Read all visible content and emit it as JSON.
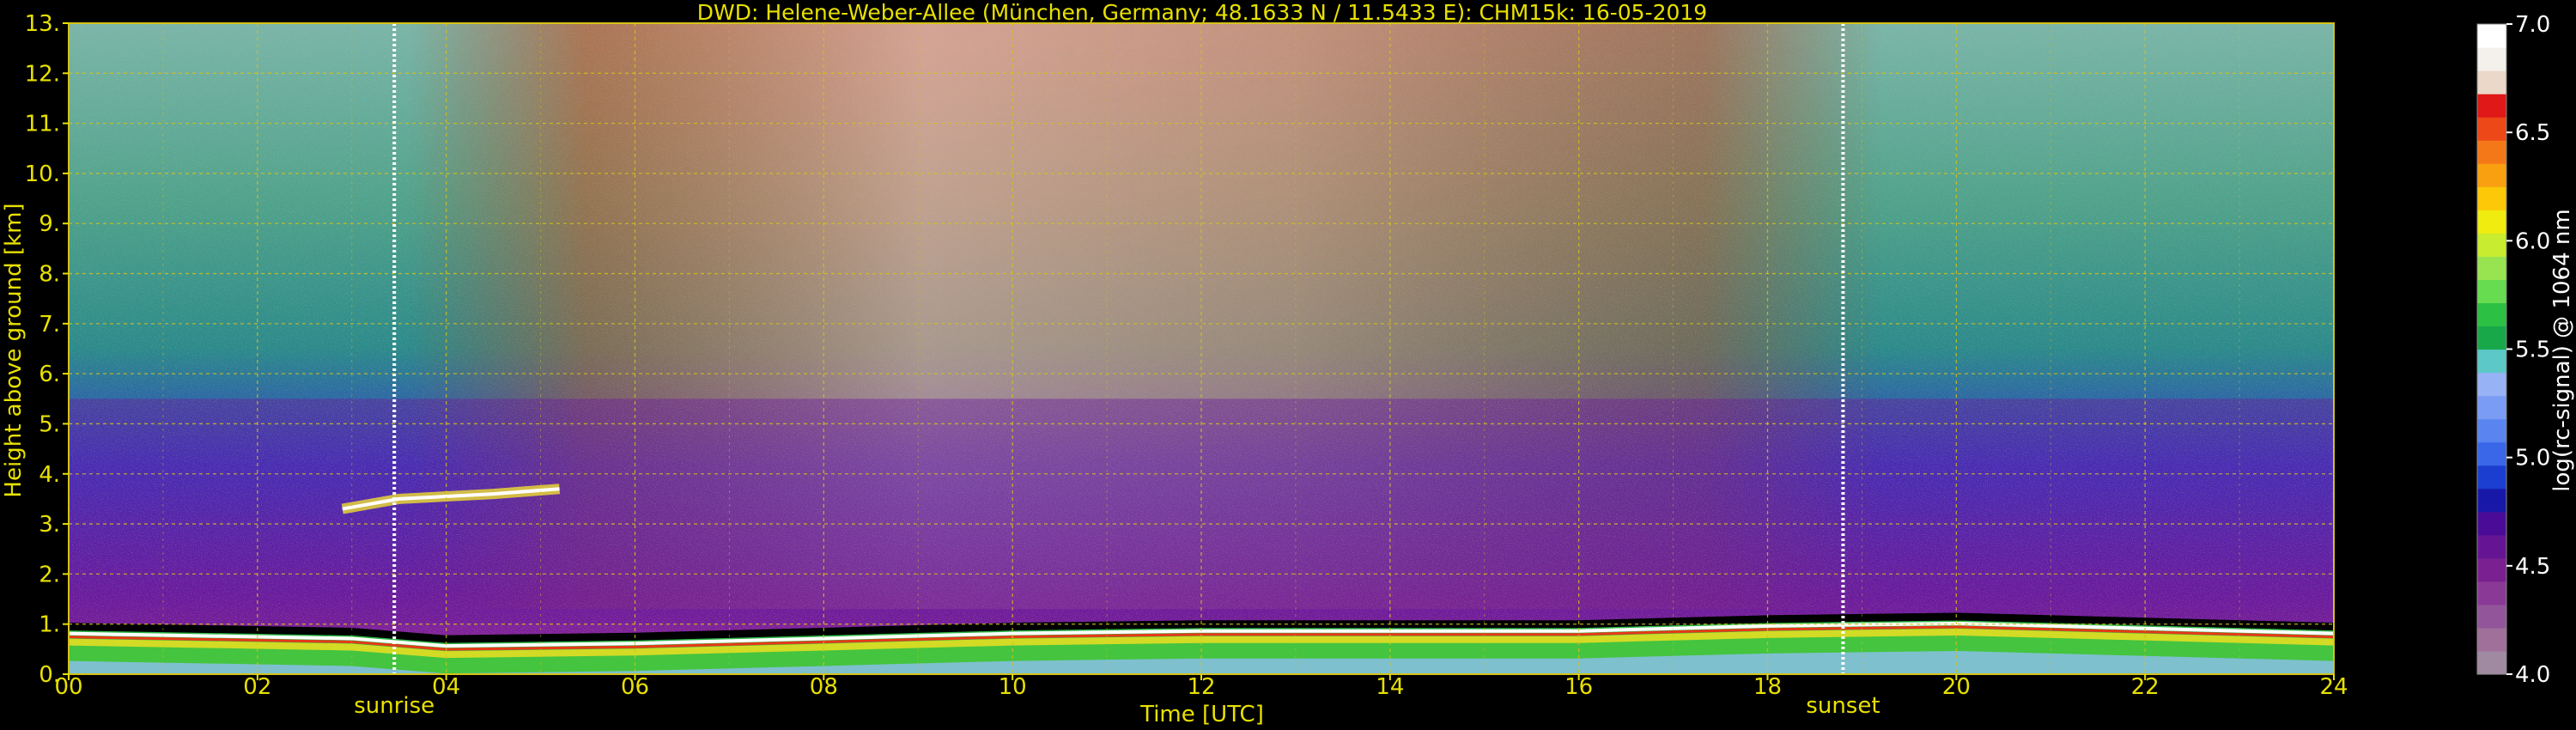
{
  "chart_data": {
    "type": "heatmap",
    "title": "DWD: Helene-Weber-Allee (München, Germany; 48.1633 N / 11.5433 E):    CHM15k: 16-05-2019",
    "xlabel": "Time [UTC]",
    "ylabel": "Height above ground [km]",
    "xlim": [
      0,
      24
    ],
    "ylim": [
      0,
      13
    ],
    "x_ticks": [
      "00",
      "02",
      "04",
      "06",
      "08",
      "10",
      "12",
      "14",
      "16",
      "18",
      "20",
      "22",
      "24"
    ],
    "y_ticks": [
      "0.",
      "1.",
      "2.",
      "3.",
      "4.",
      "5.",
      "6.",
      "7.",
      "8.",
      "9.",
      "10.",
      "11.",
      "12.",
      "13."
    ],
    "grid": true,
    "grid_color": "#d4c21a",
    "events": [
      {
        "label": "sunrise",
        "time": 3.45
      },
      {
        "label": "sunset",
        "time": 18.8
      }
    ],
    "colorbar": {
      "label": "log(rc-signal) @ 1064 nm",
      "range": [
        4.0,
        7.0
      ],
      "ticks": [
        "4.0",
        "4.5",
        "5.0",
        "5.5",
        "6.0",
        "6.5",
        "7.0"
      ],
      "colors": [
        "#a08aa2",
        "#a0709a",
        "#93559a",
        "#8a3a96",
        "#7a2090",
        "#651594",
        "#4a0c96",
        "#1818a8",
        "#1c3ed0",
        "#3a66e8",
        "#5a84f0",
        "#7a9cf4",
        "#98b2f6",
        "#5cc8c8",
        "#18a84a",
        "#2cc044",
        "#68dc50",
        "#98e450",
        "#c8ec30",
        "#f0ec10",
        "#fcc808",
        "#f8a010",
        "#f47818",
        "#ec4818",
        "#e01818",
        "#ecd8c8",
        "#f4f0ec",
        "#ffffff"
      ]
    },
    "features": [
      {
        "name": "boundary-layer-top",
        "x": [
          0,
          3,
          4,
          6,
          8,
          10,
          12,
          14,
          16,
          18,
          20,
          22,
          24
        ],
        "y": [
          0.95,
          0.85,
          0.7,
          0.75,
          0.85,
          0.95,
          1.0,
          1.0,
          1.0,
          1.1,
          1.15,
          1.05,
          0.95
        ]
      },
      {
        "name": "elevated-cloud-layer",
        "x": [
          2.9,
          3.5,
          4.5,
          5.2
        ],
        "y": [
          3.3,
          3.5,
          3.6,
          3.7
        ]
      }
    ]
  }
}
